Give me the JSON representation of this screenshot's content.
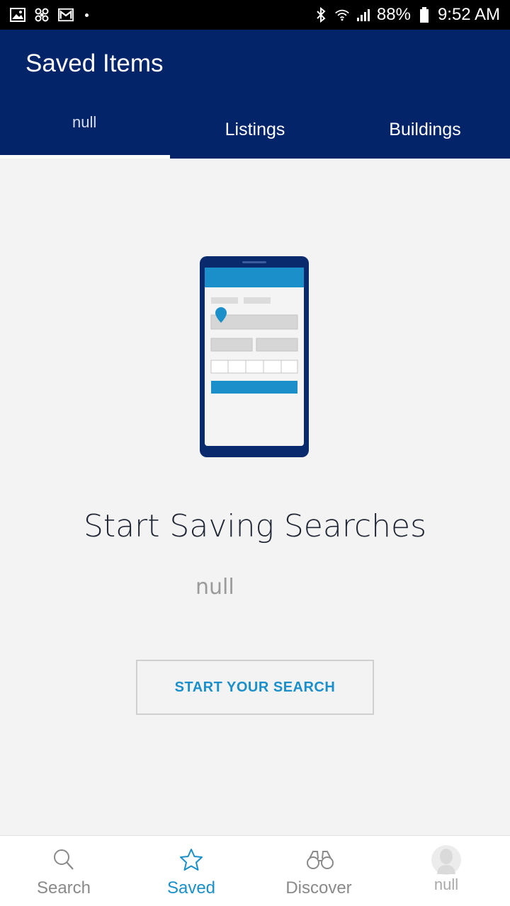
{
  "status_bar": {
    "battery": "88%",
    "time": "9:52 AM",
    "left_icons": [
      "image-icon",
      "pinwheel-icon",
      "gmail-icon"
    ],
    "right_icons": [
      "bluetooth-icon",
      "wifi-icon",
      "signal-icon",
      "battery-icon"
    ]
  },
  "app_bar": {
    "title": "Saved Items",
    "tabs": [
      {
        "label": "null",
        "active": true
      },
      {
        "label": "Listings",
        "active": false
      },
      {
        "label": "Buildings",
        "active": false
      }
    ]
  },
  "empty_state": {
    "illustration": "phone-search-form-illustration",
    "title": "Start Saving Searches",
    "subtitle": "null",
    "button_label": "START YOUR SEARCH"
  },
  "bottom_nav": {
    "items": [
      {
        "label": "Search",
        "icon": "search-icon",
        "active": false
      },
      {
        "label": "Saved",
        "icon": "star-icon",
        "active": true
      },
      {
        "label": "Discover",
        "icon": "binoculars-icon",
        "active": false
      },
      {
        "label": "null",
        "icon": "avatar-icon",
        "active": false
      }
    ]
  },
  "colors": {
    "app_bar": "#04246a",
    "accent": "#1a8fc9",
    "background": "#f3f3f4"
  }
}
